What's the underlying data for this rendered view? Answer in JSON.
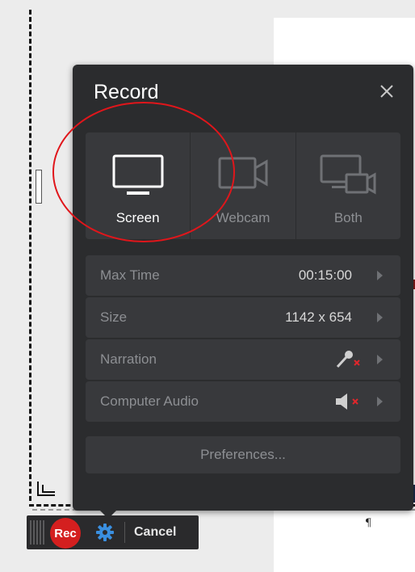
{
  "panel": {
    "title": "Record",
    "close_icon": "close-icon"
  },
  "modes": [
    {
      "label": "Screen",
      "icon": "monitor-icon",
      "active": true
    },
    {
      "label": "Webcam",
      "icon": "webcam-icon",
      "active": false
    },
    {
      "label": "Both",
      "icon": "screen-webcam-icon",
      "active": false
    }
  ],
  "settings": [
    {
      "label": "Max Time",
      "value": "00:15:00"
    },
    {
      "label": "Size",
      "value": "1142 x 654"
    },
    {
      "label": "Narration",
      "value": "",
      "icon": "microphone-muted-icon"
    },
    {
      "label": "Computer Audio",
      "value": "",
      "icon": "speaker-muted-icon"
    }
  ],
  "preferences_label": "Preferences...",
  "toolbar": {
    "rec_label": "Rec",
    "cancel_label": "Cancel",
    "gear_icon": "gear-icon"
  },
  "document": {
    "pilcrow": "¶"
  },
  "colors": {
    "panel_bg": "#2b2c2e",
    "row_bg": "#38393c",
    "rec_red": "#d41f1f",
    "annotation_red": "#e0161b",
    "gear_blue": "#3a8fe0"
  }
}
